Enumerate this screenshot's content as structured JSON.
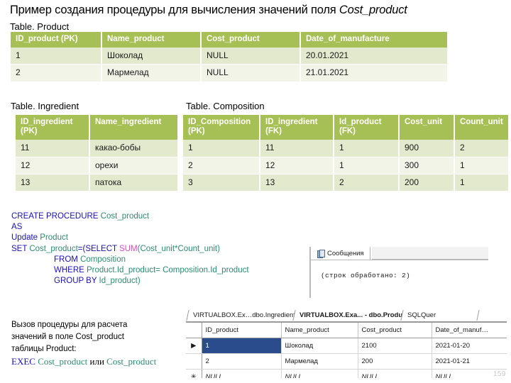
{
  "slide": {
    "title_main": "Пример создания процедуры для вычисления значений поля ",
    "title_italic": "Cost_product",
    "page_number": "159"
  },
  "tables": {
    "product": {
      "caption": "Table. Product",
      "headers": [
        "ID_product (PK)",
        "Name_product",
        "Cost_product",
        "Date_of_manufacture"
      ],
      "rows": [
        [
          "1",
          "Шоколад",
          "NULL",
          "20.01.2021"
        ],
        [
          "2",
          "Мармелад",
          "NULL",
          "21.01.2021"
        ]
      ]
    },
    "ingredient": {
      "caption": "Table. Ingredient",
      "headers": [
        "ID_ingredient (PK)",
        "Name_ingredient"
      ],
      "rows": [
        [
          "11",
          "какао-бобы"
        ],
        [
          "12",
          "орехи"
        ],
        [
          "13",
          "патока"
        ]
      ]
    },
    "composition": {
      "caption": "Table. Composition",
      "headers": [
        "ID_Composition (PK)",
        "ID_ingredient (FK)",
        "Id_product (FK)",
        "Cost_unit",
        "Count_unit"
      ],
      "rows": [
        [
          "1",
          "11",
          "1",
          "900",
          "2"
        ],
        [
          "2",
          "12",
          "1",
          "300",
          "1"
        ],
        [
          "3",
          "13",
          "2",
          "200",
          "1"
        ]
      ]
    }
  },
  "sql": {
    "l1_kw": "CREATE PROCEDURE ",
    "l1_id": "Cost_product",
    "l2_kw": "AS",
    "l3_kw": "Update ",
    "l3_id": "Product",
    "l4_kw": "SET ",
    "l4_id": "Cost_product",
    "l4_op": "=(",
    "l4_kw2": "SELECT ",
    "l4_fn": "SUM",
    "l4_args": "(Cost_unit*Count_unit)",
    "l5_kw": "FROM ",
    "l5_id": "Composition",
    "l6_kw": "WHERE ",
    "l6_id": "Product.Id_product= Composition.Id_product",
    "l7_kw": "GROUP BY ",
    "l7_id": "Id_product)"
  },
  "messages": {
    "tab_label": "Сообщения",
    "body": "(строк обработано: 2)"
  },
  "note": {
    "line1": "Вызов процедуры для расчета",
    "line2": "значений в поле Cost_product",
    "line3": "таблицы Product:",
    "exec_kw": "EXEC",
    "exec_id1": "Cost_product",
    "exec_or": "или",
    "exec_id2": "Cost_product"
  },
  "ssms": {
    "tabs": [
      "VIRTUALBOX.Ex…dbo.Ingredient",
      "VIRTUALBOX.Exa... - dbo.Product",
      "SQLQuer"
    ],
    "active_tab_index": 1,
    "headers": [
      "ID_product",
      "Name_product",
      "Cost_product",
      "Date_of_manuf…"
    ],
    "rows": [
      {
        "marker": "▶",
        "cells": [
          "1",
          "Шоколад",
          "2100",
          "2021-01-20"
        ],
        "selected": 0
      },
      {
        "marker": "",
        "cells": [
          "2",
          "Мармелад",
          "200",
          "2021-01-21"
        ],
        "selected": -1
      },
      {
        "marker": "✳",
        "cells": [
          "NULL",
          "NULL",
          "NULL",
          "NULL"
        ],
        "selected": -1,
        "isnull": true
      }
    ]
  }
}
